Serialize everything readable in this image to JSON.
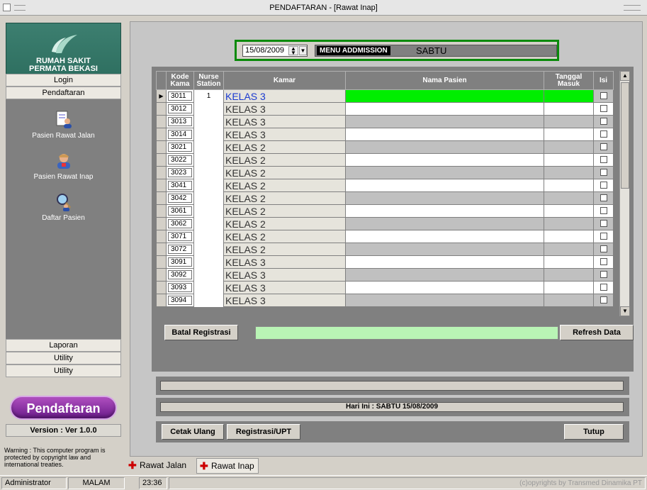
{
  "window": {
    "title": "PENDAFTARAN - [Rawat Inap]"
  },
  "sidebar": {
    "logo_line1": "RUMAH SAKIT",
    "logo_line2": "PERMATA BEKASI",
    "buttons_top": [
      "Login",
      "Pendaftaran"
    ],
    "items": [
      {
        "label": "Pasien Rawat Jalan",
        "icon": "document-user-icon"
      },
      {
        "label": "Pasien Rawat Inap",
        "icon": "inpatient-user-icon"
      },
      {
        "label": "Daftar Pasien",
        "icon": "search-user-icon"
      }
    ],
    "buttons_bottom": [
      "Laporan",
      "Utility",
      "Utility"
    ],
    "active_module": "Pendaftaran",
    "version": "Version : Ver 1.0.0",
    "warning": "Warning : This computer program is protected by copyright law and international treaties."
  },
  "header": {
    "date": "15/08/2009",
    "menu_label": "MENU ADDMISSION",
    "day": "SABTU"
  },
  "grid": {
    "columns": [
      "Kode Kama",
      "Nurse Station",
      "Kamar",
      "Nama Pasien",
      "Tanggal Masuk",
      "Isi"
    ],
    "rows": [
      {
        "kode": "3011",
        "nurse": "1",
        "kamar": "KELAS 3"
      },
      {
        "kode": "3012",
        "nurse": "",
        "kamar": "KELAS 3"
      },
      {
        "kode": "3013",
        "nurse": "",
        "kamar": "KELAS 3"
      },
      {
        "kode": "3014",
        "nurse": "",
        "kamar": "KELAS 3"
      },
      {
        "kode": "3021",
        "nurse": "",
        "kamar": "KELAS 2"
      },
      {
        "kode": "3022",
        "nurse": "",
        "kamar": "KELAS 2"
      },
      {
        "kode": "3023",
        "nurse": "",
        "kamar": "KELAS 2"
      },
      {
        "kode": "3041",
        "nurse": "",
        "kamar": "KELAS 2"
      },
      {
        "kode": "3042",
        "nurse": "",
        "kamar": "KELAS 2"
      },
      {
        "kode": "3061",
        "nurse": "",
        "kamar": "KELAS 2"
      },
      {
        "kode": "3062",
        "nurse": "",
        "kamar": "KELAS 2"
      },
      {
        "kode": "3071",
        "nurse": "",
        "kamar": "KELAS 2"
      },
      {
        "kode": "3072",
        "nurse": "",
        "kamar": "KELAS 2"
      },
      {
        "kode": "3091",
        "nurse": "",
        "kamar": "KELAS 3"
      },
      {
        "kode": "3092",
        "nurse": "",
        "kamar": "KELAS 3"
      },
      {
        "kode": "3093",
        "nurse": "",
        "kamar": "KELAS 3"
      },
      {
        "kode": "3094",
        "nurse": "",
        "kamar": "KELAS 3"
      }
    ]
  },
  "buttons": {
    "batal": "Batal Registrasi",
    "refresh": "Refresh Data",
    "cetak": "Cetak Ulang",
    "registrasi": "Registrasi/UPT",
    "tutup": "Tutup"
  },
  "info_text": "Hari Ini : SABTU   15/08/2009",
  "tabs": [
    "Rawat Jalan",
    "Rawat Inap"
  ],
  "status": {
    "user": "Administrator",
    "shift": "MALAM",
    "time": "23:36",
    "copyright": "(c)opyrights by Transmed Dinamika PT"
  },
  "colors": {
    "selected_row": "#00ee00",
    "accent": "#0a8a0a",
    "brand": "#2b6c5d",
    "module_button": "#8a2aa8"
  }
}
